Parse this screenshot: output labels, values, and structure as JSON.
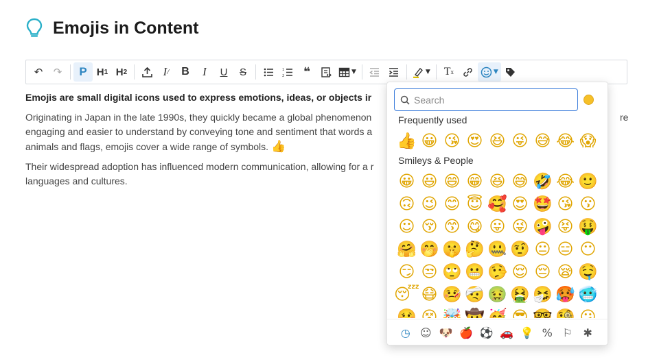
{
  "page": {
    "title": "Emojis in Content",
    "title_icon": "lightbulb-icon",
    "accent_color": "#2bb0c9"
  },
  "toolbar": {
    "items": [
      {
        "name": "undo-button",
        "glyph": "↶",
        "state": "normal"
      },
      {
        "name": "redo-button",
        "glyph": "↷",
        "state": "disabled"
      },
      {
        "name": "paragraph-button",
        "glyph": "P",
        "state": "active"
      },
      {
        "name": "heading1-button",
        "glyph": "H1",
        "state": "normal"
      },
      {
        "name": "heading2-button",
        "glyph": "H2",
        "state": "normal"
      },
      {
        "name": "anchor-button",
        "glyph": "⊥",
        "state": "normal"
      },
      {
        "name": "clear-styles-button",
        "glyph": "I̸",
        "state": "normal"
      },
      {
        "name": "bold-button",
        "glyph": "B",
        "state": "normal"
      },
      {
        "name": "italic-button",
        "glyph": "I",
        "state": "normal"
      },
      {
        "name": "underline-button",
        "glyph": "U",
        "state": "normal"
      },
      {
        "name": "strikethrough-button",
        "glyph": "S",
        "state": "normal"
      },
      {
        "name": "bullet-list-button",
        "glyph": "☰",
        "state": "normal"
      },
      {
        "name": "numbered-list-button",
        "glyph": "≡",
        "state": "normal"
      },
      {
        "name": "blockquote-button",
        "glyph": "❝",
        "state": "normal"
      },
      {
        "name": "code-block-button",
        "glyph": "⧉",
        "state": "normal"
      },
      {
        "name": "table-button",
        "glyph": "▦",
        "state": "normal"
      },
      {
        "name": "outdent-button",
        "glyph": "⇤",
        "state": "disabled"
      },
      {
        "name": "indent-button",
        "glyph": "⇥",
        "state": "normal"
      },
      {
        "name": "highlight-button",
        "glyph": "✎",
        "state": "normal"
      },
      {
        "name": "clear-format-button",
        "glyph": "T",
        "state": "normal"
      },
      {
        "name": "link-button",
        "glyph": "⛓",
        "state": "normal"
      },
      {
        "name": "emoji-button",
        "glyph": "☺",
        "state": "active"
      },
      {
        "name": "tag-button",
        "glyph": "⬟",
        "state": "normal"
      }
    ]
  },
  "content": {
    "lead": "Emojis are small digital icons used to express emotions, ideas, or objects ir",
    "para1_a": "Originating in Japan in the late 1990s, they quickly became a global phenomenon",
    "para1_tail": "re",
    "para1_b": "engaging and easier to understand by conveying tone and sentiment that words a",
    "para1_c": "animals and flags, emojis cover a wide range of symbols.",
    "para1_emoji": "👍",
    "para2_a": "Their widespread adoption has influenced modern communication, allowing for a r",
    "para2_b": "languages and cultures."
  },
  "picker": {
    "search_placeholder": "Search",
    "skin_tone_color": "#f6c028",
    "frequent_label": "Frequently used",
    "frequent": [
      "👍",
      "😀",
      "😘",
      "😍",
      "😆",
      "😜",
      "😅",
      "😂",
      "😱"
    ],
    "smileys_label": "Smileys & People",
    "smileys": [
      [
        "😀",
        "😃",
        "😄",
        "😁",
        "😆",
        "😅",
        "🤣",
        "😂",
        "🙂"
      ],
      [
        "🙃",
        "😉",
        "😊",
        "😇",
        "🥰",
        "😍",
        "🤩",
        "😘",
        "😗"
      ],
      [
        "☺",
        "😚",
        "😙",
        "😋",
        "😛",
        "😜",
        "🤪",
        "😝",
        "🤑"
      ],
      [
        "🤗",
        "🤭",
        "🤫",
        "🤔",
        "🤐",
        "🤨",
        "😐",
        "😑",
        "😶"
      ],
      [
        "😏",
        "😒",
        "🙄",
        "😬",
        "🤥",
        "😌",
        "😔",
        "😪",
        "🤤"
      ],
      [
        "😴",
        "😷",
        "🤒",
        "🤕",
        "🤢",
        "🤮",
        "🤧",
        "🥵",
        "🥶"
      ],
      [
        "🥴",
        "😵",
        "🤯",
        "🤠",
        "🥳",
        "😎",
        "🤓",
        "🧐",
        "😕"
      ]
    ],
    "categories": [
      {
        "name": "recent-tab",
        "glyph": "◷",
        "active": true
      },
      {
        "name": "smileys-tab",
        "glyph": "☺",
        "active": false
      },
      {
        "name": "animals-tab",
        "glyph": "🐶",
        "active": false
      },
      {
        "name": "food-tab",
        "glyph": "🍎",
        "active": false
      },
      {
        "name": "activity-tab",
        "glyph": "⚽",
        "active": false
      },
      {
        "name": "travel-tab",
        "glyph": "🚗",
        "active": false
      },
      {
        "name": "objects-tab",
        "glyph": "💡",
        "active": false
      },
      {
        "name": "symbols-tab",
        "glyph": "%",
        "active": false
      },
      {
        "name": "flags-tab",
        "glyph": "⚐",
        "active": false
      },
      {
        "name": "custom-tab",
        "glyph": "✱",
        "active": false
      }
    ]
  }
}
